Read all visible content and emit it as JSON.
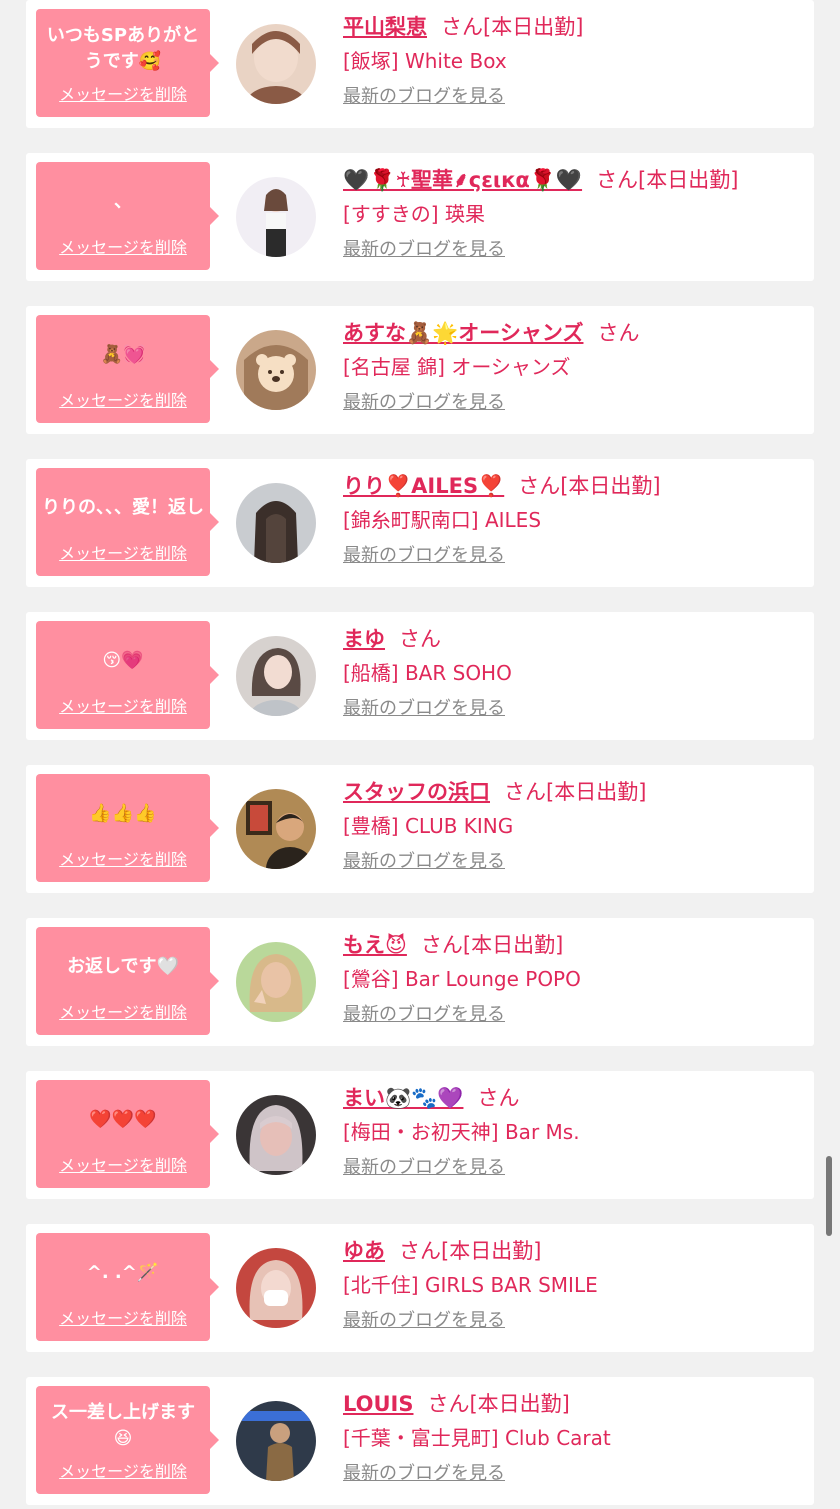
{
  "delete_label": "メッセージを削除",
  "blog_label": "最新のブログを見る",
  "cards": [
    {
      "message": "いつもSPありがとうです🥰",
      "name": "平山梨恵",
      "suffix": "さん[本日出勤]",
      "shop": "[飯塚] White Box",
      "avatar": {
        "bg": "#e9d3c4",
        "fg": "#8a5a45"
      }
    },
    {
      "message": "、",
      "name": "🖤🌹♰聖華⸙ςειкα🌹🖤",
      "suffix": "さん[本日出勤]",
      "shop": "[すすきの] 瑛果",
      "avatar": {
        "bg": "#f1eef4",
        "fg": "#2b2b2b"
      }
    },
    {
      "message": "🧸💓",
      "name": "あすな🧸🌟オーシャンズ",
      "suffix": "さん",
      "shop": "[名古屋 錦] オーシャンズ",
      "avatar": {
        "bg": "#caa88a",
        "fg": "#f6dfc4"
      }
    },
    {
      "message": "りりの、、、愛！返し",
      "name": "りり❣️AILES❣️",
      "suffix": "さん[本日出勤]",
      "shop": "[錦糸町駅南口] AILES",
      "avatar": {
        "bg": "#c9ccd0",
        "fg": "#3b2f2a"
      }
    },
    {
      "message": "😚💗",
      "name": "まゆ",
      "suffix": "さん",
      "shop": "[船橋] BAR SOHO",
      "avatar": {
        "bg": "#d7d2cf",
        "fg": "#5a4a44"
      }
    },
    {
      "message": "👍👍👍",
      "name": "スタッフの浜口",
      "suffix": "さん[本日出勤]",
      "shop": "[豊橋] CLUB KING",
      "avatar": {
        "bg": "#b08a55",
        "fg": "#2a231c"
      }
    },
    {
      "message": "お返しです🤍",
      "name": "もえ😈",
      "suffix": "さん[本日出勤]",
      "shop": "[鶯谷] Bar Lounge POPO",
      "avatar": {
        "bg": "#b9d89a",
        "fg": "#e9c3a6"
      }
    },
    {
      "message": "❤️❤️❤️",
      "name": "まい🐼🐾💜",
      "suffix": "さん",
      "shop": "[梅田・お初天神] Bar Ms.",
      "avatar": {
        "bg": "#3a3536",
        "fg": "#e6bfb8"
      }
    },
    {
      "message": "^. .^🪄",
      "name": "ゆあ",
      "suffix": "さん[本日出勤]",
      "shop": "[北千住] GIRLS BAR SMILE",
      "avatar": {
        "bg": "#c4473f",
        "fg": "#f3d9d0"
      }
    },
    {
      "message": "ス一差し上げます😆",
      "name": "LOUIS",
      "suffix": "さん[本日出勤]",
      "shop": "[千葉・富士見町] Club Carat",
      "avatar": {
        "bg": "#2f3a4a",
        "fg": "#8a6a44"
      }
    }
  ]
}
